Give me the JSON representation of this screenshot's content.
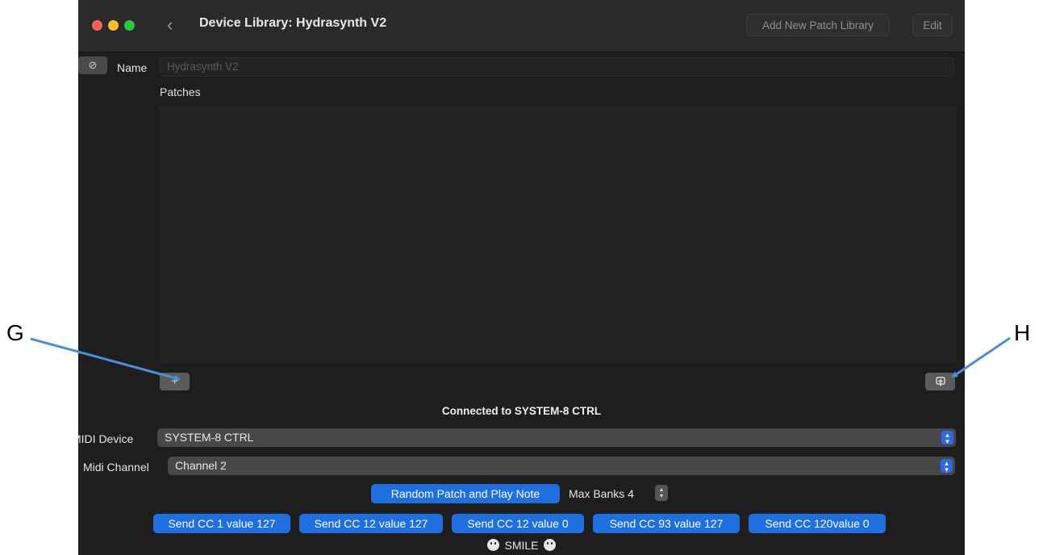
{
  "window": {
    "title": "Device Library: Hydrasynth V2",
    "add_library_label": "Add New Patch Library",
    "edit_label": "Edit"
  },
  "form": {
    "name_label": "Name",
    "name_placeholder": "Hydrasynth V2",
    "patches_label": "Patches",
    "add_label": "+"
  },
  "status": "Connected to SYSTEM-8 CTRL",
  "midi": {
    "device_label": "MIDI Device",
    "device_value": "SYSTEM-8 CTRL",
    "channel_label": "Midi Channel",
    "channel_value": "Channel 2"
  },
  "actions": {
    "random_patch": "Random Patch and Play Note",
    "max_banks_label": "Max Banks 4",
    "cc_buttons": [
      "Send CC 1 value 127",
      "Send CC 12 value 127",
      "Send CC 12 value 0",
      "Send CC 93 value 127",
      "Send CC 120value 0"
    ]
  },
  "smile": "SMILE",
  "callouts": {
    "g": "G",
    "h": "H"
  },
  "colors": {
    "accent": "#1f6fe0",
    "background": "#1e1e1e",
    "arrow": "#4a8fd8"
  }
}
